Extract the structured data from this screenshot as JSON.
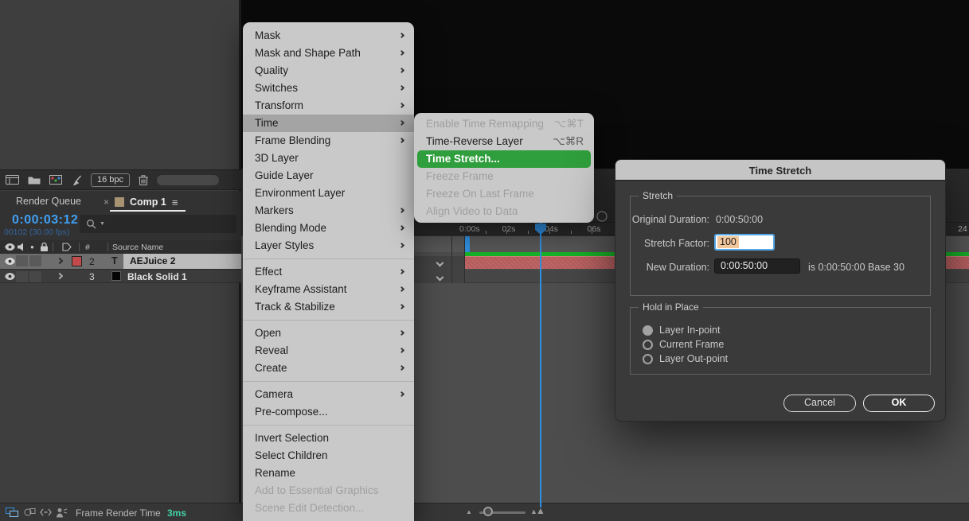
{
  "left_panel": {
    "toolbar": {
      "bpc": "16 bpc",
      "icons": [
        "render-settings",
        "folder",
        "color-workspace",
        "brush",
        "trash"
      ]
    },
    "tabs": {
      "render_queue": "Render Queue",
      "close": "×",
      "comp": "Comp 1",
      "menu_glyph": "≡"
    },
    "time": {
      "timecode": "0:00:03:12",
      "frames": "00102 (30.00 fps)"
    },
    "layers": {
      "columns": {
        "hash": "#",
        "source": "Source Name"
      },
      "rows": [
        {
          "num": "2",
          "type": "text",
          "type_glyph": "T",
          "name": "AEJuice 2",
          "label_color": "#c14a4a",
          "selected": true
        },
        {
          "num": "3",
          "type": "solid",
          "type_glyph": "",
          "name": "Black Solid 1",
          "swatch_color": "#050505",
          "selected": false
        }
      ]
    },
    "status": {
      "label": "Frame Render Time",
      "value": "3ms"
    }
  },
  "context_menu": {
    "items": [
      {
        "label": "Mask",
        "submenu": true
      },
      {
        "label": "Mask and Shape Path",
        "submenu": true
      },
      {
        "label": "Quality",
        "submenu": true
      },
      {
        "label": "Switches",
        "submenu": true
      },
      {
        "label": "Transform",
        "submenu": true
      },
      {
        "label": "Time",
        "submenu": true,
        "highlighted": true
      },
      {
        "label": "Frame Blending",
        "submenu": true
      },
      {
        "label": "3D Layer"
      },
      {
        "label": "Guide Layer"
      },
      {
        "label": "Environment Layer"
      },
      {
        "label": "Markers",
        "submenu": true
      },
      {
        "label": "Blending Mode",
        "submenu": true
      },
      {
        "label": "Layer Styles",
        "submenu": true
      },
      {
        "separator": true
      },
      {
        "label": "Effect",
        "submenu": true
      },
      {
        "label": "Keyframe Assistant",
        "submenu": true
      },
      {
        "label": "Track & Stabilize",
        "submenu": true
      },
      {
        "separator": true
      },
      {
        "label": "Open",
        "submenu": true
      },
      {
        "label": "Reveal",
        "submenu": true
      },
      {
        "label": "Create",
        "submenu": true
      },
      {
        "separator": true
      },
      {
        "label": "Camera",
        "submenu": true
      },
      {
        "label": "Pre-compose..."
      },
      {
        "separator": true
      },
      {
        "label": "Invert Selection"
      },
      {
        "label": "Select Children"
      },
      {
        "label": "Rename"
      },
      {
        "label": "Add to Essential Graphics",
        "disabled": true
      },
      {
        "label": "Scene Edit Detection...",
        "disabled": true
      }
    ]
  },
  "time_submenu": {
    "items": [
      {
        "label": "Enable Time Remapping",
        "shortcut": "⌥⌘T",
        "disabled": true
      },
      {
        "label": "Time-Reverse Layer",
        "shortcut": "⌥⌘R"
      },
      {
        "label": "Time Stretch...",
        "selected": true
      },
      {
        "label": "Freeze Frame",
        "disabled": true
      },
      {
        "label": "Freeze On Last Frame",
        "disabled": true
      },
      {
        "label": "Align Video to Data",
        "disabled": true
      }
    ]
  },
  "dialog": {
    "title": "Time Stretch",
    "stretch_group": {
      "legend": "Stretch",
      "original_duration_label": "Original Duration:",
      "original_duration_value": "0:00:50:00",
      "stretch_factor_label": "Stretch Factor:",
      "stretch_factor_value": "100",
      "new_duration_label": "New Duration:",
      "new_duration_value": "0:00:50:00",
      "new_duration_note": "is 0:00:50:00  Base 30"
    },
    "hold_group": {
      "legend": "Hold in Place",
      "options": [
        {
          "label": "Layer In-point",
          "selected": true
        },
        {
          "label": "Current Frame",
          "selected": false
        },
        {
          "label": "Layer Out-point",
          "selected": false
        }
      ]
    },
    "buttons": {
      "cancel": "Cancel",
      "ok": "OK"
    }
  },
  "timeline": {
    "ticks": [
      "0:00s",
      "02s",
      "04s",
      "06s"
    ],
    "right_tick": "24"
  },
  "colors": {
    "accent_blue": "#2f8fe0",
    "timecode_blue": "#3fa0f5",
    "menu_green": "#2f9e3c",
    "cache_green": "#17b327",
    "layer_bar_red": "#c06565",
    "render_time_teal": "#41d1a5"
  }
}
